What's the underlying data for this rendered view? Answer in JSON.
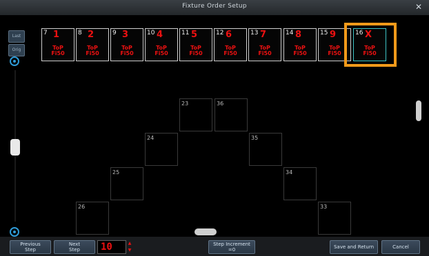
{
  "window": {
    "title": "Fixture Order Setup"
  },
  "left_rail": {
    "btn1": "Last",
    "btn2": "Orig"
  },
  "top_fixtures": [
    {
      "num": "7",
      "name": "1",
      "logo1": "ToP",
      "logo2": "Fi50"
    },
    {
      "num": "8",
      "name": "2",
      "logo1": "ToP",
      "logo2": "Fi50"
    },
    {
      "num": "9",
      "name": "3",
      "logo1": "ToP",
      "logo2": "Fi50"
    },
    {
      "num": "10",
      "name": "4",
      "logo1": "ToP",
      "logo2": "Fi50"
    },
    {
      "num": "11",
      "name": "5",
      "logo1": "ToP",
      "logo2": "Fi50"
    },
    {
      "num": "12",
      "name": "6",
      "logo1": "ToP",
      "logo2": "Fi50"
    },
    {
      "num": "13",
      "name": "7",
      "logo1": "ToP",
      "logo2": "Fi50"
    },
    {
      "num": "14",
      "name": "8",
      "logo1": "ToP",
      "logo2": "Fi50"
    },
    {
      "num": "15",
      "name": "9",
      "logo1": "ToP",
      "logo2": "Fi50"
    },
    {
      "num": "16",
      "name": "X",
      "logo1": "ToP",
      "logo2": "Fi50"
    }
  ],
  "grid_fixtures": [
    {
      "num": "23"
    },
    {
      "num": "36"
    },
    {
      "num": "24"
    },
    {
      "num": "35"
    },
    {
      "num": "25"
    },
    {
      "num": "34"
    },
    {
      "num": "26"
    },
    {
      "num": "33"
    }
  ],
  "footer": {
    "previous_step_line1": "Previous",
    "previous_step_line2": "Step",
    "next_step_line1": "Next",
    "next_step_line2": "Step",
    "step_value": "10",
    "step_increment_line1": "Step Increment",
    "step_increment_line2": "=0",
    "save_return": "Save and Return",
    "cancel": "Cancel"
  },
  "colors": {
    "accent_highlight": "#f39a1a",
    "fixture_text": "#e11111",
    "selected_border": "#3ec6c8"
  }
}
